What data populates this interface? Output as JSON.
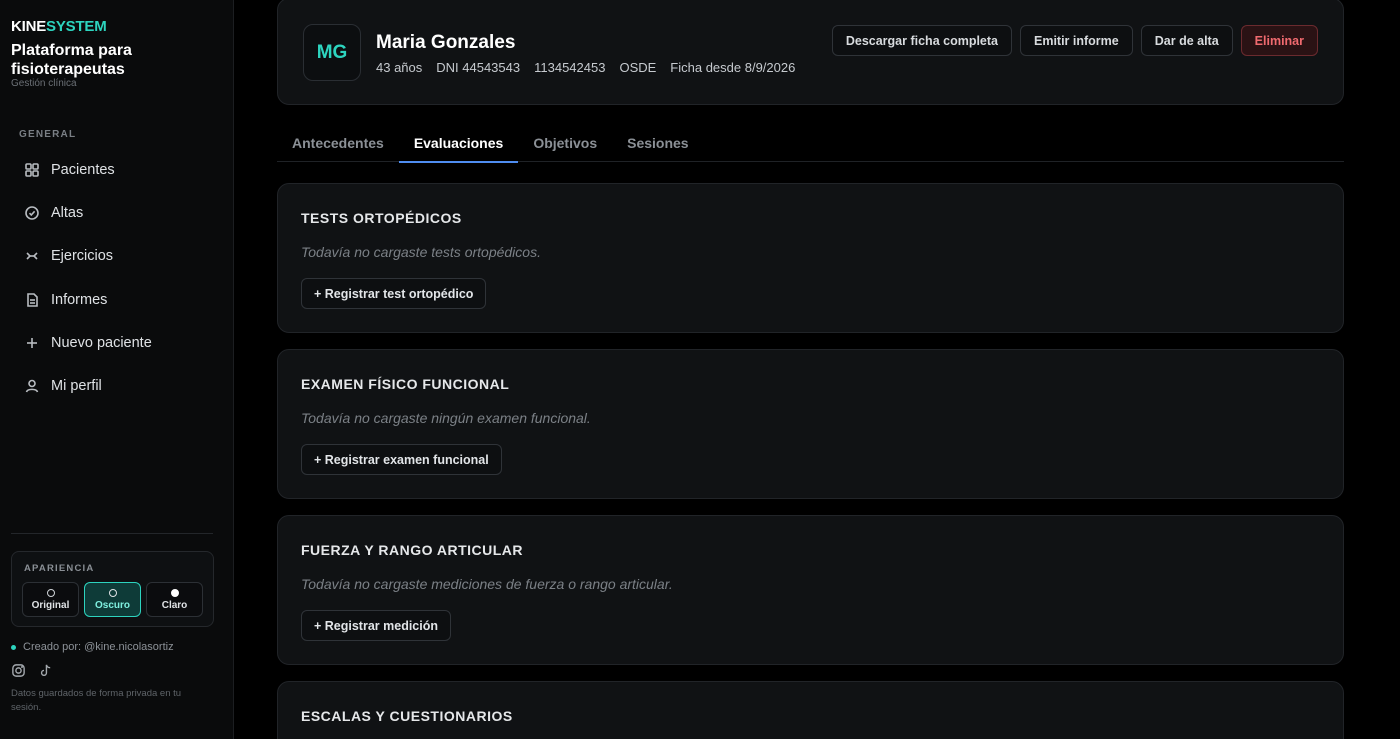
{
  "brand": {
    "part1": "KINE",
    "part2": "SYSTEM",
    "tagline": "Plataforma para fisioterapeutas",
    "subtitle": "Gestión clínica"
  },
  "sidebar": {
    "section": "GENERAL",
    "items": [
      {
        "label": "Pacientes",
        "icon": "grid-icon"
      },
      {
        "label": "Altas",
        "icon": "check-circle-icon"
      },
      {
        "label": "Ejercicios",
        "icon": "exercise-icon"
      },
      {
        "label": "Informes",
        "icon": "document-icon"
      },
      {
        "label": "Nuevo paciente",
        "icon": "plus-icon"
      },
      {
        "label": "Mi perfil",
        "icon": "user-icon"
      }
    ],
    "appearance": {
      "title": "APARIENCIA",
      "options": [
        "Original",
        "Oscuro",
        "Claro"
      ],
      "selected": "Oscuro"
    },
    "credit": "Creado por: @kine.nicolasortiz",
    "privacy": "Datos guardados de forma privada en tu sesión."
  },
  "patient": {
    "initials": "MG",
    "name": "Maria Gonzales",
    "age": "43 años",
    "dni": "DNI 44543543",
    "phone": "1134542453",
    "insurance": "OSDE",
    "since": "Ficha desde 8/9/2026"
  },
  "actions": {
    "download": "Descargar ficha completa",
    "report": "Emitir informe",
    "discharge": "Dar de alta",
    "delete": "Eliminar"
  },
  "tabs": [
    "Antecedentes",
    "Evaluaciones",
    "Objetivos",
    "Sesiones"
  ],
  "active_tab": "Evaluaciones",
  "sections": [
    {
      "title": "TESTS ORTOPÉDICOS",
      "empty": "Todavía no cargaste tests ortopédicos.",
      "button": "+ Registrar test ortopédico"
    },
    {
      "title": "EXAMEN FÍSICO FUNCIONAL",
      "empty": "Todavía no cargaste ningún examen funcional.",
      "button": "+ Registrar examen funcional"
    },
    {
      "title": "FUERZA Y RANGO ARTICULAR",
      "empty": "Todavía no cargaste mediciones de fuerza o rango articular.",
      "button": "+ Registrar medición"
    },
    {
      "title": "ESCALAS Y CUESTIONARIOS"
    }
  ],
  "colors": {
    "accent": "#2dd4bf",
    "tab_indicator": "#4f8df0",
    "danger": "#f06a6f",
    "background": "#000000",
    "card": "#101214"
  }
}
